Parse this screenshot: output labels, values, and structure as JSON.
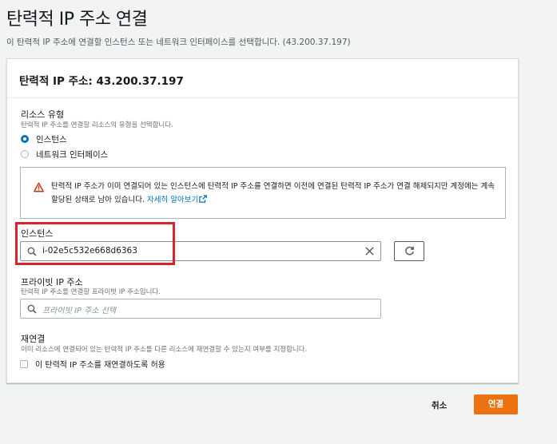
{
  "page": {
    "title": "탄력적 IP 주소 연결",
    "description": "이 탄력적 IP 주소에 연결할 인스턴스 또는 네트워크 인터페이스를 선택합니다. (43.200.37.197)"
  },
  "panel": {
    "title": "탄력적 IP 주소: 43.200.37.197"
  },
  "resource_type": {
    "label": "리소스 유형",
    "description": "탄력적 IP 주소를 연결할 리소스의 유형을 선택합니다.",
    "options": [
      {
        "label": "인스턴스",
        "selected": true
      },
      {
        "label": "네트워크 인터페이스",
        "selected": false
      }
    ]
  },
  "alert": {
    "icon": "warning-icon",
    "text": "탄력적 IP 주소가 이미 연결되어 있는 인스턴스에 탄력적 IP 주소를 연결하면 이전에 연결된 탄력적 IP 주소가 연결 해제되지만 계정에는 계속 할당된 상태로 남아 있습니다.",
    "link": "자세히 알아보기"
  },
  "instance": {
    "label": "인스턴스",
    "value": "i-02e5c532e668d6363"
  },
  "private_ip": {
    "label": "프라이빗 IP 주소",
    "description": "탄력적 IP 주소를 연결할 프라이빗 IP 주소입니다.",
    "placeholder": "프라이빗 IP 주소 선택"
  },
  "reassociation": {
    "label": "재연결",
    "description": "이미 리소스에 연결되어 있는 탄력적 IP 주소를 다른 리소스에 재연결할 수 있는지 여부를 지정합니다.",
    "checkbox_label": "이 탄력적 IP 주소를 재연결하도록 허용",
    "checked": false
  },
  "footer": {
    "cancel": "취소",
    "submit": "연결"
  },
  "colors": {
    "accent": "#0073bb",
    "primary": "#ec7211",
    "highlight": "#d8232a",
    "warning": "#d13212"
  }
}
